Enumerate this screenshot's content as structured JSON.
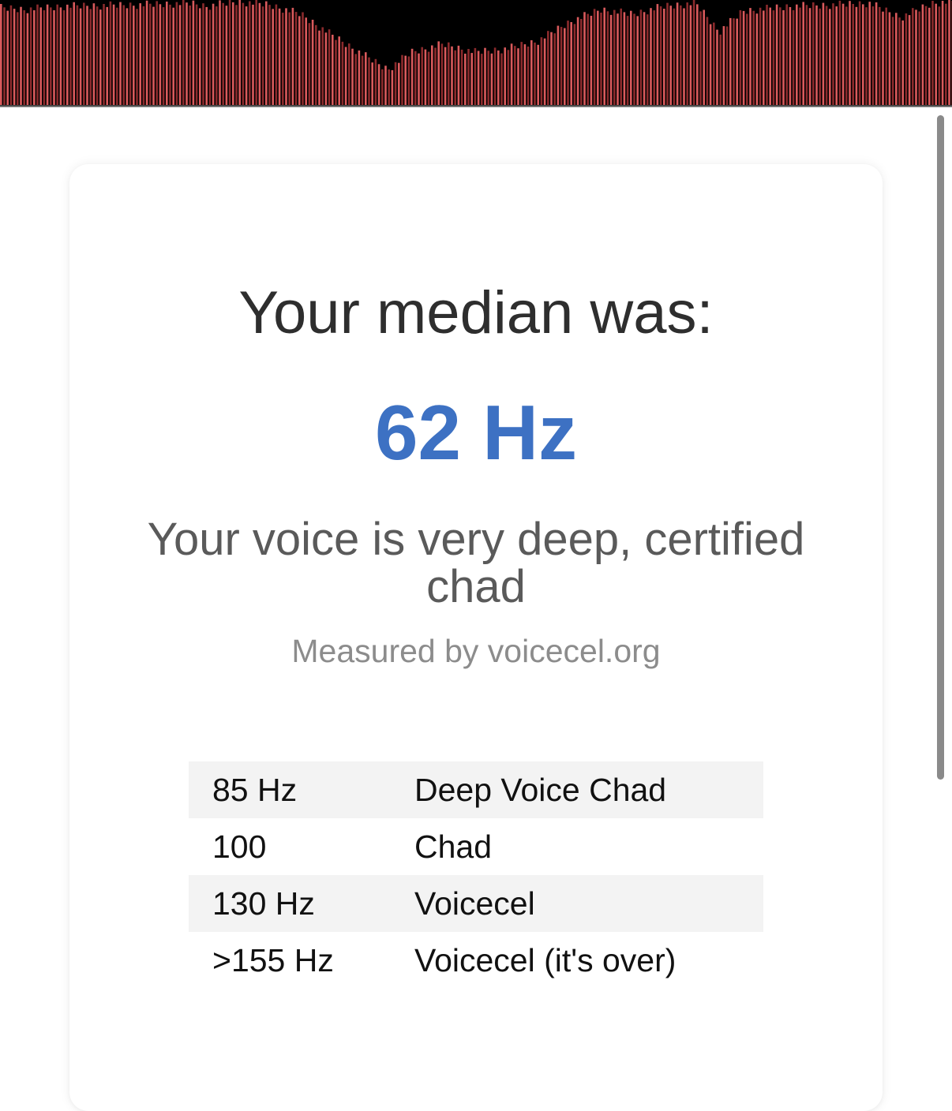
{
  "visualizer": {
    "bar_color": "#8b2a2c",
    "bar_highlight": "#d95a5c",
    "background": "#000000"
  },
  "result": {
    "heading": "Your median was:",
    "value": "62 Hz",
    "value_color": "#3d71c3",
    "verdict": "Your voice is very deep, certified chad",
    "credit": "Measured by voicecel.org"
  },
  "reference_table": {
    "rows": [
      {
        "frequency": "85 Hz",
        "label": "Deep Voice Chad"
      },
      {
        "frequency": "100",
        "label": "Chad"
      },
      {
        "frequency": "130 Hz",
        "label": "Voicecel"
      },
      {
        "frequency": ">155 Hz",
        "label": "Voicecel (it's over)"
      }
    ]
  }
}
